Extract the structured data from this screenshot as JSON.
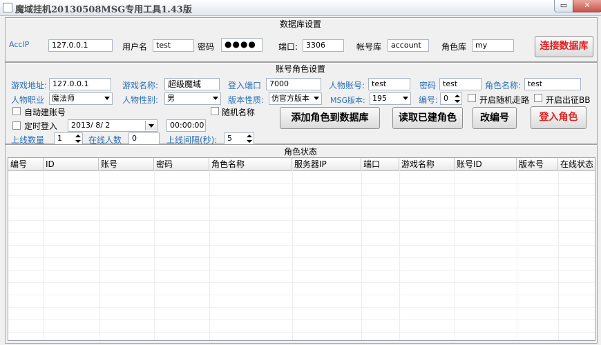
{
  "window": {
    "title": "魔域挂机20130508MSG专用工具1.43版",
    "min_label": "▭",
    "close_label": "✕"
  },
  "db_group": {
    "title": "数据库设置",
    "acc_ip_label": "AccIP",
    "acc_ip_value": "127.0.0.1",
    "user_label": "用户名",
    "user_value": "test",
    "pwd_label": "密码",
    "pwd_value": "●●●●",
    "port_label": "端口:",
    "port_value": "3306",
    "account_db_label": "帐号库",
    "account_db_value": "account",
    "role_db_label": "角色库",
    "role_db_value": "my",
    "connect_button": "连接数据库"
  },
  "account_group": {
    "title": "账号角色设置",
    "game_addr_label": "游戏地址:",
    "game_addr_value": "127.0.0.1",
    "game_name_label": "游戏名称:",
    "game_name_value": "超级魔域",
    "login_port_label": "登入端口",
    "login_port_value": "7000",
    "char_account_label": "人物账号:",
    "char_account_value": "test",
    "pwd_label": "密码",
    "pwd_value": "test",
    "role_name_label": "角色名称:",
    "role_name_value": "test",
    "profession_label": "人物职业",
    "profession_value": "魔法师",
    "gender_label": "人物性别:",
    "gender_value": "男",
    "version_type_label": "版本性质:",
    "version_type_value": "仿官方版本",
    "msg_version_label": "MSG版本:",
    "msg_version_value": "195",
    "number_label": "编号:",
    "number_value": "0",
    "random_walk_label": "开启随机走路",
    "expedition_label": "开启出征BB",
    "auto_account_label": "自动建账号",
    "random_name_label": "随机名称",
    "timed_login_label": "定时登入",
    "date_value": "2013/ 8/ 2",
    "time_value": "00:00:00",
    "online_count_label": "上线数量",
    "online_count_value": "1",
    "online_people_label": "在线人数",
    "online_people_value": "0",
    "interval_label": "上线间隔(秒):",
    "interval_value": "5",
    "add_role_button": "添加角色到数据库",
    "read_roles_button": "读取已建角色",
    "rename_button": "改编号",
    "login_role_button": "登入角色"
  },
  "status_group": {
    "title": "角色状态",
    "columns": [
      "编号",
      "ID",
      "账号",
      "密码",
      "角色名称",
      "服务器IP",
      "端口",
      "游戏名称",
      "账号ID",
      "版本号",
      "在线状态"
    ]
  }
}
